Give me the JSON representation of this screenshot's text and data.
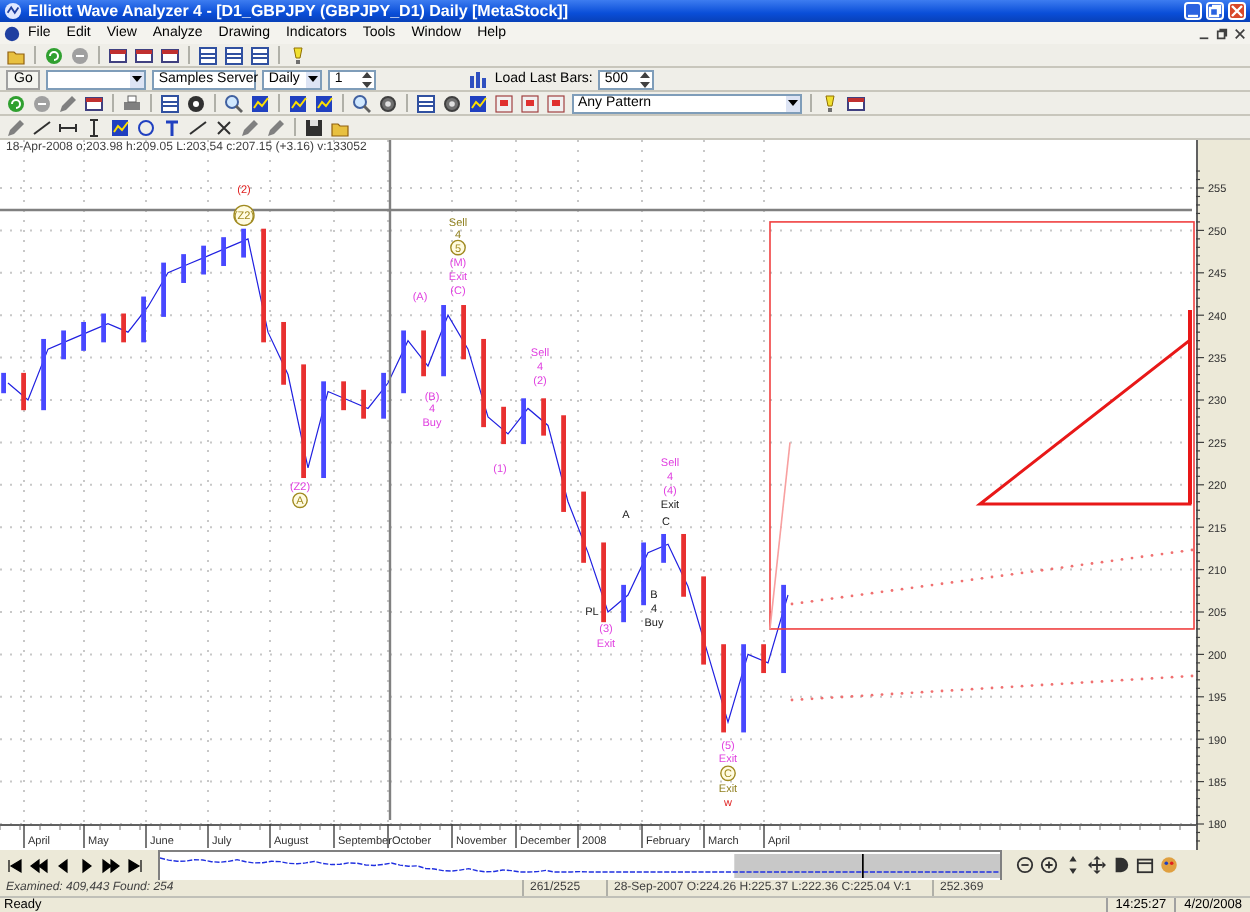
{
  "window": {
    "title": "Elliott Wave Analyzer 4 - [D1_GBPJPY  (GBPJPY_D1)  Daily [MetaStock]]"
  },
  "menu": [
    "File",
    "Edit",
    "View",
    "Analyze",
    "Drawing",
    "Indicators",
    "Tools",
    "Window",
    "Help"
  ],
  "toolbar": {
    "go": "Go",
    "server": "Samples Server",
    "period": "Daily",
    "multiplier": "1",
    "load_label": "Load Last Bars:",
    "load_bars": "500",
    "pattern": "Any Pattern"
  },
  "chart": {
    "info": "18-Apr-2008  o:203.98 h:209.05 L:203.54 c:207.15 (+3.16) v:133052",
    "chart_data": {
      "type": "line",
      "grid": true,
      "series": [
        {
          "color": "#2020e0",
          "values": [
            232,
            230,
            236,
            237,
            238,
            239,
            238,
            241,
            245,
            246,
            247,
            248,
            249,
            238,
            233,
            222,
            231,
            230,
            229,
            232,
            237,
            234,
            240,
            236,
            228,
            226,
            229,
            227,
            218,
            212,
            205,
            207,
            212,
            213,
            208,
            200,
            192,
            200,
            199,
            207
          ]
        }
      ],
      "ylim": [
        180,
        255
      ],
      "yticks": [
        180,
        185,
        190,
        195,
        200,
        205,
        210,
        215,
        220,
        225,
        230,
        235,
        240,
        245,
        250,
        255
      ]
    },
    "time_axis": [
      "April",
      "May",
      "June",
      "July",
      "August",
      "September",
      "October",
      "November",
      "December",
      "2008",
      "February",
      "March",
      "April"
    ],
    "wave_labels": [
      {
        "text": "(2)",
        "kind": "degree"
      },
      {
        "text": "(Z2)",
        "kind": "circled"
      },
      {
        "text": "(Z2)",
        "kind": "wave"
      },
      {
        "text": "A",
        "kind": "circled"
      },
      {
        "text": "Sell",
        "kind": "trade"
      },
      {
        "text": "4",
        "kind": "trade"
      },
      {
        "text": "5",
        "kind": "circled"
      },
      {
        "text": "(M)",
        "kind": "wave"
      },
      {
        "text": "Exit",
        "kind": "wave"
      },
      {
        "text": "(C)",
        "kind": "wave"
      },
      {
        "text": "(A)",
        "kind": "wave"
      },
      {
        "text": "(B)",
        "kind": "wave"
      },
      {
        "text": "4",
        "kind": "wave"
      },
      {
        "text": "Buy",
        "kind": "wave"
      },
      {
        "text": "Sell",
        "kind": "wave"
      },
      {
        "text": "4",
        "kind": "wave"
      },
      {
        "text": "(2)",
        "kind": "wave"
      },
      {
        "text": "(1)",
        "kind": "wave"
      },
      {
        "text": "Sell",
        "kind": "wave"
      },
      {
        "text": "4",
        "kind": "wave"
      },
      {
        "text": "(4)",
        "kind": "wave"
      },
      {
        "text": "Exit",
        "kind": "signal"
      },
      {
        "text": "A",
        "kind": "signal"
      },
      {
        "text": "C",
        "kind": "signal"
      },
      {
        "text": "PL",
        "kind": "signal"
      },
      {
        "text": "(3)",
        "kind": "wave"
      },
      {
        "text": "Exit",
        "kind": "wave"
      },
      {
        "text": "B",
        "kind": "signal"
      },
      {
        "text": "4",
        "kind": "signal"
      },
      {
        "text": "Buy",
        "kind": "signal"
      },
      {
        "text": "(5)",
        "kind": "wave"
      },
      {
        "text": "Exit",
        "kind": "wave"
      },
      {
        "text": "C",
        "kind": "circled"
      },
      {
        "text": "Exit",
        "kind": "trade"
      },
      {
        "text": "w",
        "kind": "degree"
      }
    ]
  },
  "status": {
    "examined": "Examined: 409,443  Found: 254",
    "bar_index": "261/2525",
    "bar_info": "28-Sep-2007  O:224.26 H:225.37 L:222.36 C:225.04 V:1",
    "cursor_price": "252.369",
    "message": "Ready",
    "time": "14:25:27",
    "date": "4/20/2008"
  }
}
